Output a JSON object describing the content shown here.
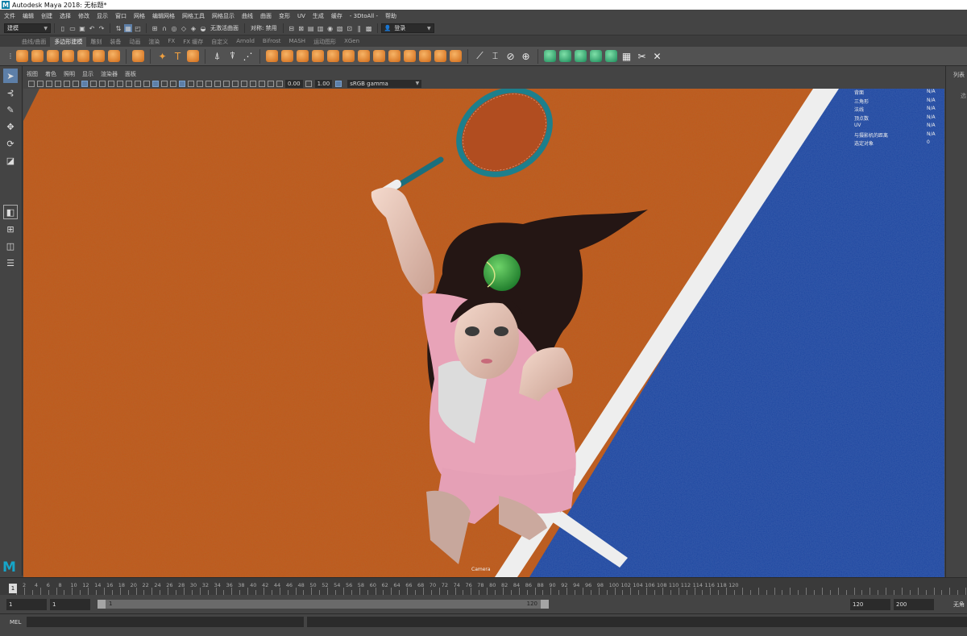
{
  "window": {
    "title": "Autodesk Maya 2018: 无标题*"
  },
  "menubar": [
    "文件",
    "编辑",
    "创建",
    "选择",
    "修改",
    "显示",
    "窗口",
    "网格",
    "编辑网格",
    "网格工具",
    "网格显示",
    "曲线",
    "曲面",
    "变形",
    "UV",
    "生成",
    "缓存",
    "- 3DtoAll -",
    "帮助"
  ],
  "statusline": {
    "mode": "建模",
    "live_surface": "无激活曲面",
    "symmetry": "对称: 禁用",
    "login": "登录"
  },
  "shelf_tabs": [
    "曲线/曲面",
    "多边形建模",
    "雕刻",
    "装备",
    "动画",
    "渲染",
    "FX",
    "FX 缓存",
    "自定义",
    "Arnold",
    "Bifrost",
    "MASH",
    "运动图形",
    "XGen"
  ],
  "shelf_tabs_active": 1,
  "viewport_menu": [
    "视图",
    "着色",
    "照明",
    "显示",
    "渲染器",
    "面板"
  ],
  "viewport_tools": {
    "exposure": "0.00",
    "gamma": "1.00",
    "colorspace": "sRGB gamma"
  },
  "hud": [
    {
      "label": "背面",
      "value": "N/A"
    },
    {
      "label": "三角形",
      "value": "N/A"
    },
    {
      "label": "法线",
      "value": "N/A"
    },
    {
      "label": "顶点数",
      "value": "N/A"
    },
    {
      "label": "UV",
      "value": "N/A"
    },
    {
      "label": "与摄影机的距离",
      "value": "N/A"
    },
    {
      "label": "选定对象",
      "value": "0"
    }
  ],
  "camera_label": "Camera",
  "maya_logo": "M",
  "right_panel": {
    "title": "列表",
    "sub": "选"
  },
  "timeline": {
    "current_frame": "1",
    "ticks": [
      "2",
      "4",
      "6",
      "8",
      "10",
      "12",
      "14",
      "16",
      "18",
      "20",
      "22",
      "24",
      "26",
      "28",
      "30",
      "32",
      "34",
      "36",
      "38",
      "40",
      "42",
      "44",
      "46",
      "48",
      "50",
      "52",
      "54",
      "56",
      "58",
      "60",
      "62",
      "64",
      "66",
      "68",
      "70",
      "72",
      "74",
      "76",
      "78",
      "80",
      "82",
      "84",
      "86",
      "88",
      "90",
      "92",
      "94",
      "96",
      "98",
      "100",
      "102",
      "104",
      "106",
      "108",
      "110",
      "112",
      "114",
      "116",
      "118",
      "120"
    ]
  },
  "range": {
    "start": "1",
    "playback_start": "1",
    "bar_start": "1",
    "bar_end": "120",
    "playback_end": "120",
    "end": "200",
    "char_set": "无角"
  },
  "cmdline": {
    "label": "MEL"
  },
  "colors": {
    "clay": "#c1591e",
    "blue_court": "#1d47a0",
    "line": "#f2f2f2",
    "shirt": "#e8a3b8",
    "ball": "#2ea23a",
    "racket": "#1d7f8c"
  }
}
